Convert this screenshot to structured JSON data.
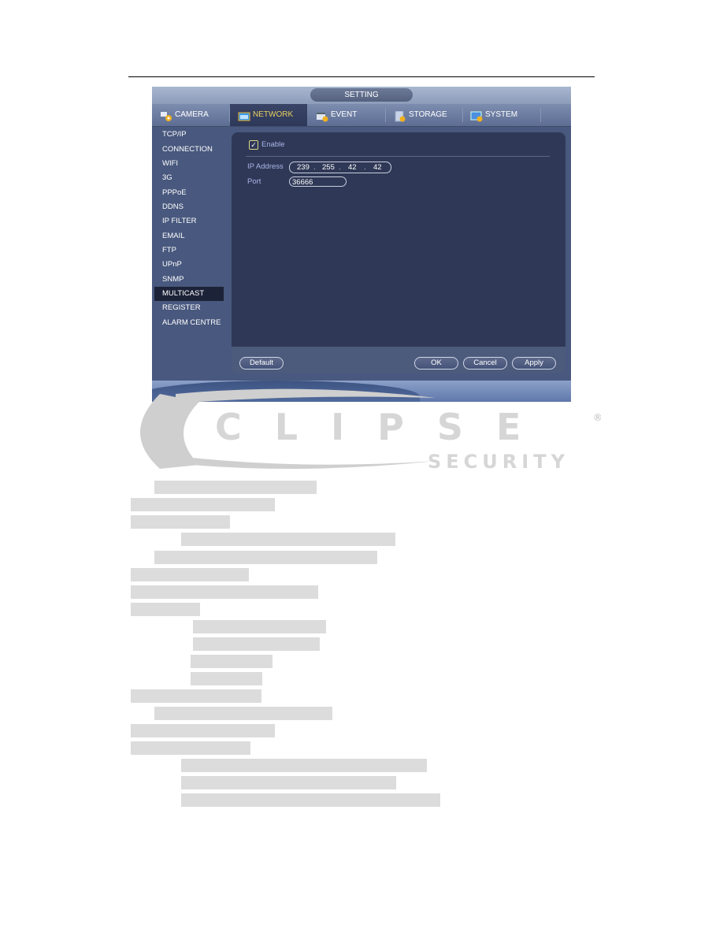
{
  "window": {
    "title": "SETTING",
    "tabs": [
      {
        "label": "CAMERA",
        "icon": "camera-settings-icon",
        "active": false
      },
      {
        "label": "NETWORK",
        "icon": "network-icon",
        "active": true
      },
      {
        "label": "EVENT",
        "icon": "event-icon",
        "active": false
      },
      {
        "label": "STORAGE",
        "icon": "storage-icon",
        "active": false
      },
      {
        "label": "SYSTEM",
        "icon": "system-icon",
        "active": false
      }
    ],
    "sidebar": {
      "items": [
        "TCP/IP",
        "CONNECTION",
        "WIFI",
        "3G",
        "PPPoE",
        "DDNS",
        "IP FILTER",
        "EMAIL",
        "FTP",
        "UPnP",
        "SNMP",
        "MULTICAST",
        "REGISTER",
        "ALARM CENTRE"
      ],
      "active": "MULTICAST"
    },
    "form": {
      "enable_label": "Enable",
      "enable_checked": true,
      "ip_label": "IP Address",
      "ip": [
        "239",
        "255",
        "42",
        "42"
      ],
      "port_label": "Port",
      "port": "36666"
    },
    "buttons": {
      "default": "Default",
      "ok": "OK",
      "cancel": "Cancel",
      "apply": "Apply"
    },
    "colors": {
      "active_tab_text": "#e8d060",
      "label": "#aab6ea",
      "panel": "#2f3856"
    }
  },
  "logo": {
    "brand": "CLIPSE",
    "sub": "SECURITY",
    "mark": "®"
  }
}
